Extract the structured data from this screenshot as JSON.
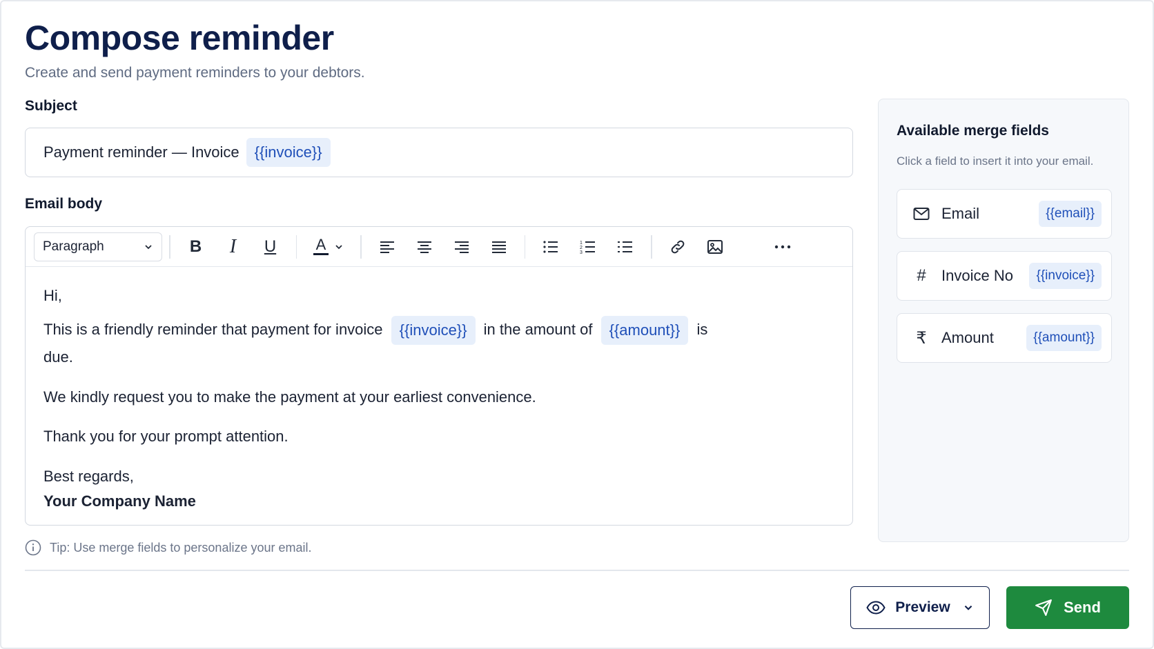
{
  "page": {
    "title": "Compose reminder",
    "subtitle": "Create and send payment reminders to your debtors."
  },
  "subject": {
    "label": "Subject",
    "text": "Payment reminder — Invoice",
    "chip": "{{invoice}}"
  },
  "email_body": {
    "label": "Email body",
    "toolbar": {
      "paragraph_select": "Paragraph",
      "icons": [
        "bold-icon",
        "italic-icon",
        "underline-icon",
        "text-color-icon",
        "align-left-icon",
        "align-center-icon",
        "align-right-icon",
        "align-justify-icon",
        "bullet-list-icon",
        "numbered-list-icon",
        "checklist-icon",
        "link-icon",
        "image-icon",
        "more-icon"
      ]
    },
    "greeting": "Hi,",
    "line_part1": "This is a friendly reminder that payment for invoice",
    "line_chip1": "{{invoice}}",
    "line_part2": "in the amount of",
    "line_chip2": "{{amount}}",
    "line_part3": "is",
    "line_part4": "due.",
    "request": "We kindly request you to make the payment at your earliest convenience.",
    "thanks": "Thank you for your prompt attention.",
    "regards": "Best regards,",
    "company": "Your Company Name"
  },
  "tip": "Tip: Use merge fields to personalize your email.",
  "merge_fields": {
    "title": "Available merge fields",
    "subtitle": "Click a field to insert it into your email.",
    "items": [
      {
        "icon": "mail-icon",
        "label": "Email",
        "chip": "{{email}}"
      },
      {
        "icon": "hash-icon",
        "label": "Invoice No",
        "chip": "{{invoice}}"
      },
      {
        "icon": "rupee-icon",
        "label": "Amount",
        "chip": "{{amount}}"
      }
    ]
  },
  "actions": {
    "preview_label": "Preview",
    "send_label": "Send"
  },
  "colors": {
    "title": "#0f1f4b",
    "chip_bg": "#e7effb",
    "chip_text": "#1f4fb8",
    "send_button": "#1e8a3e"
  }
}
